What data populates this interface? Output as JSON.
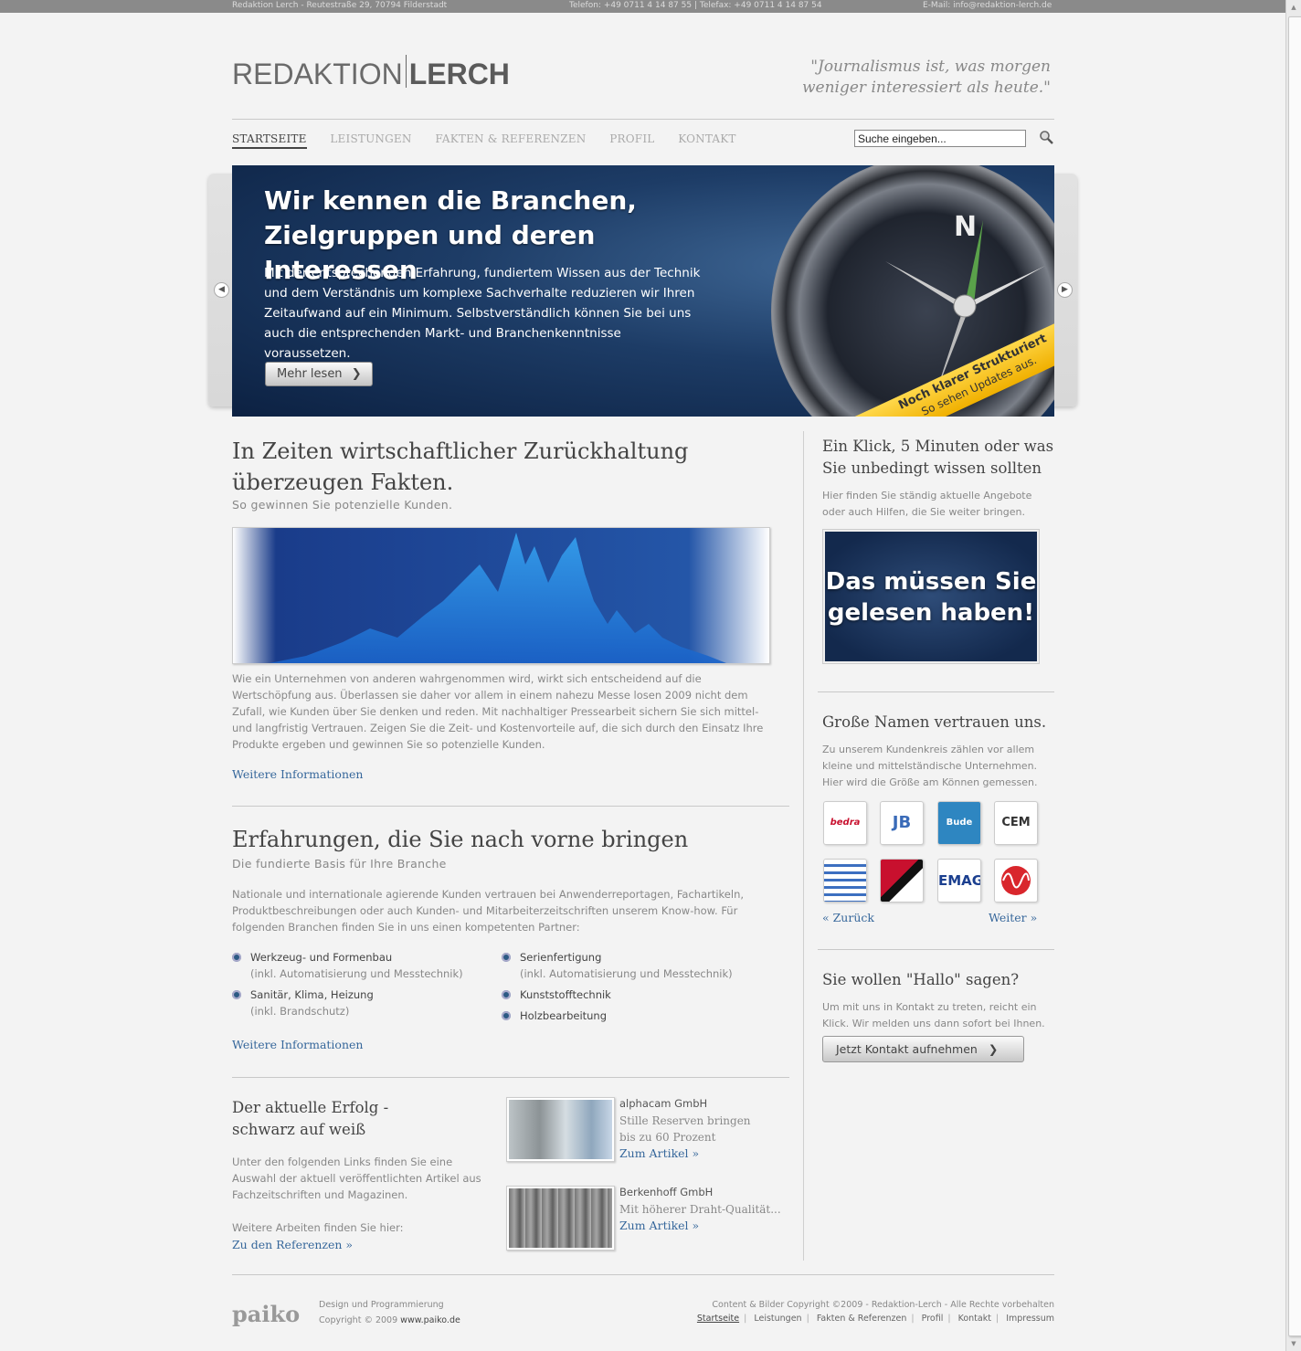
{
  "topbar": {
    "address": "Redaktion Lerch - Reutestraße 29, 70794 Filderstadt",
    "phone": "Telefon: +49 0711 4 14 87 55 | Telefax: +49 0711 4 14 87 54",
    "email": "E-Mail: info@redaktion-lerch.de"
  },
  "logo": {
    "part1": "REDAKTION",
    "part2": "LERCH"
  },
  "quote": {
    "line1": "\"Journalismus ist, was morgen",
    "line2": "weniger interessiert als heute.\""
  },
  "nav": {
    "items": [
      "STARTSEITE",
      "LEISTUNGEN",
      "FAKTEN & REFERENZEN",
      "PROFIL",
      "KONTAKT"
    ],
    "active": "STARTSEITE"
  },
  "search": {
    "value": "Suche eingeben...",
    "icon": "search-icon"
  },
  "slide": {
    "title_line1": "Wir kennen die Branchen,",
    "title_line2": "Zielgruppen und deren Interessen",
    "text": "Mit der entsprechenden Erfahrung, fundiertem Wissen aus der Technik und dem Verständnis um komplexe Sachverhalte reduzieren wir Ihren Zeitaufwand auf ein Minimum. Selbstverständlich können Sie bei uns auch die entsprechenden Markt- und Branchenkenntnisse voraussetzen.",
    "button": "Mehr lesen",
    "compass_north": "N",
    "ribbon_title": "Noch klarer Strukturiert",
    "ribbon_sub": "So sehen Updates aus."
  },
  "section1": {
    "title": "In Zeiten wirtschaftlicher Zurückhaltung überzeugen Fakten.",
    "subtitle": "So gewinnen Sie potenzielle Kunden.",
    "text": "Wie ein Unternehmen von anderen wahrgenommen wird, wirkt sich entscheidend auf die Wertschöpfung aus. Überlassen sie daher vor allem in einem nahezu Messe losen 2009 nicht dem Zufall, wie Kunden über Sie denken und reden. Mit nachhaltiger Pressearbeit sichern Sie sich mittel- und langfristig Vertrauen. Zeigen Sie die Zeit- und Kostenvorteile auf, die sich durch den Einsatz Ihre Produkte ergeben und gewinnen Sie so potenzielle Kunden.",
    "link": "Weitere Informationen"
  },
  "section2": {
    "title": "Erfahrungen, die Sie nach vorne bringen",
    "subtitle": "Die fundierte Basis für Ihre Branche",
    "text": "Nationale und internationale agierende Kunden vertrauen bei Anwenderreportagen, Fachartikeln, Produktbeschreibungen oder auch Kunden- und Mitarbeiterzeitschriften unserem Know-how. Für folgenden Branchen finden Sie in uns einen kompetenten Partner:",
    "list_left": [
      {
        "label": "Werkzeug- und Formenbau",
        "note": "(inkl. Automatisierung und Messtechnik)"
      },
      {
        "label": "Sanitär, Klima, Heizung",
        "note": "(inkl. Brandschutz)"
      }
    ],
    "list_right": [
      {
        "label": "Serienfertigung",
        "note": "(inkl. Automatisierung und Messtechnik)"
      },
      {
        "label": "Kunststofftechnik",
        "note": ""
      },
      {
        "label": "Holzbearbeitung",
        "note": ""
      }
    ],
    "link": "Weitere Informationen"
  },
  "section3": {
    "title_line1": "Der aktuelle Erfolg -",
    "title_line2": "schwarz auf weiß",
    "text": "Unter den folgenden Links finden Sie eine Auswahl der aktuell veröffentlichten Artikel aus Fachzeitschriften und Magazinen.",
    "more_text": "Weitere Arbeiten finden Sie hier:",
    "more_link": "Zu den Referenzen »",
    "articles": [
      {
        "company": "alphacam GmbH",
        "desc1": "Stille Reserven bringen",
        "desc2": "bis zu 60 Prozent",
        "link": "Zum Artikel »"
      },
      {
        "company": "Berkenhoff GmbH",
        "desc1": "Mit höherer Draht-Qualität...",
        "desc2": "",
        "link": "Zum Artikel »"
      }
    ]
  },
  "sidebar": {
    "box1": {
      "title_line1": "Ein Klick, 5 Minuten oder was",
      "title_line2": "Sie unbedingt wissen sollten",
      "text": "Hier finden Sie ständig aktuelle Angebote oder auch Hilfen, die Sie weiter bringen.",
      "banner_line1": "Das müssen Sie",
      "banner_line2": "gelesen haben!"
    },
    "box2": {
      "title": "Große Namen vertrauen uns.",
      "text": "Zu unserem Kundenkreis zählen vor allem kleine und mittelständische Unternehmen. Hier wird die Größe am Können gemessen.",
      "logos": [
        "bedra",
        "JB",
        "Bude",
        "CEM",
        "logo-5",
        "logo-6",
        "EMAG",
        "logo-8"
      ],
      "prev": "« Zurück",
      "next": "Weiter »"
    },
    "box3": {
      "title": "Sie wollen \"Hallo\" sagen?",
      "text": "Um mit uns in Kontakt zu treten, reicht ein Klick. Wir melden uns dann sofort bei Ihnen.",
      "button": "Jetzt Kontakt aufnehmen"
    }
  },
  "footer": {
    "brand": "paiko",
    "design": "Design und Programmierung",
    "copyright": "Copyright © 2009",
    "site": "www.paiko.de",
    "content_copyright": "Content & Bilder Copyright ©2009 - Redaktion-Lerch - Alle Rechte vorbehalten",
    "nav": [
      "Startseite",
      "Leistungen",
      "Fakten & Referenzen",
      "Profil",
      "Kontakt",
      "Impressum"
    ]
  },
  "colors": {
    "link": "#36679b",
    "ribbon": "#f5c400",
    "slide_bg": "#1d3c66"
  }
}
